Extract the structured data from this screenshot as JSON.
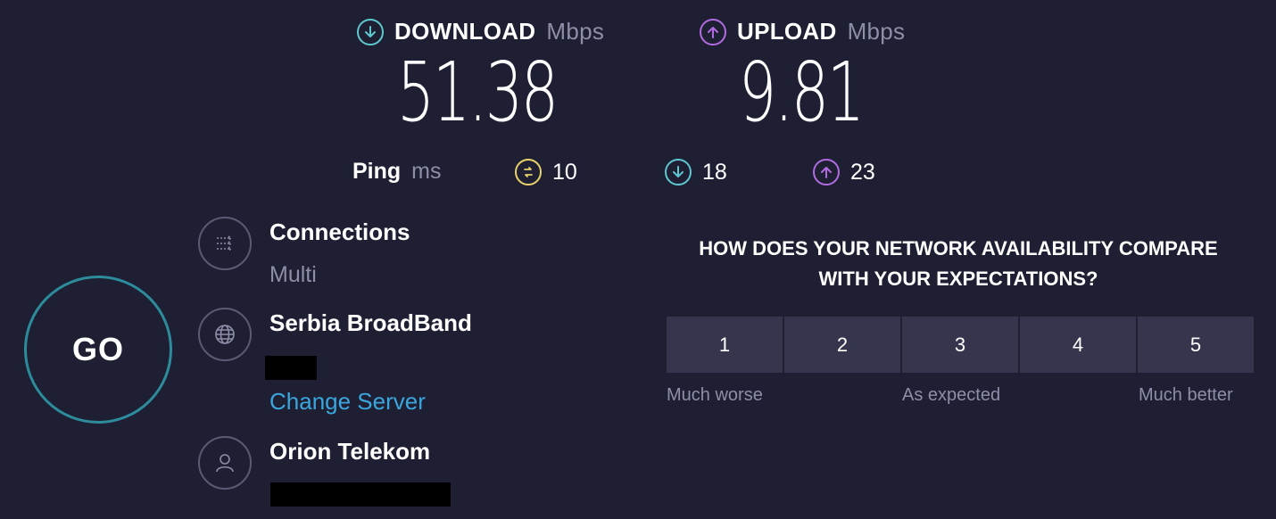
{
  "download": {
    "label": "DOWNLOAD",
    "unit": "Mbps",
    "value": "51.38",
    "icon": "download-arrow-icon",
    "color": "#5ec8cf"
  },
  "upload": {
    "label": "UPLOAD",
    "unit": "Mbps",
    "value": "9.81",
    "icon": "upload-arrow-icon",
    "color": "#b06be0"
  },
  "ping": {
    "label": "Ping",
    "unit": "ms",
    "idle": {
      "value": "10",
      "icon": "ping-idle-icon",
      "color": "#e8d36a"
    },
    "download": {
      "value": "18",
      "icon": "ping-download-icon",
      "color": "#5ec8cf"
    },
    "upload": {
      "value": "23",
      "icon": "ping-upload-icon",
      "color": "#b06be0"
    }
  },
  "go_button": {
    "label": "GO"
  },
  "connections": {
    "title": "Connections",
    "value": "Multi",
    "icon": "connections-icon"
  },
  "server": {
    "title": "Serbia BroadBand",
    "change_label": "Change Server",
    "icon": "globe-icon"
  },
  "provider": {
    "title": "Orion Telekom",
    "icon": "user-icon"
  },
  "survey": {
    "question_line1": "HOW DOES YOUR NETWORK AVAILABILITY COMPARE",
    "question_line2": "WITH YOUR EXPECTATIONS?",
    "options": [
      "1",
      "2",
      "3",
      "4",
      "5"
    ],
    "caption_low": "Much worse",
    "caption_mid": "As expected",
    "caption_high": "Much better"
  }
}
